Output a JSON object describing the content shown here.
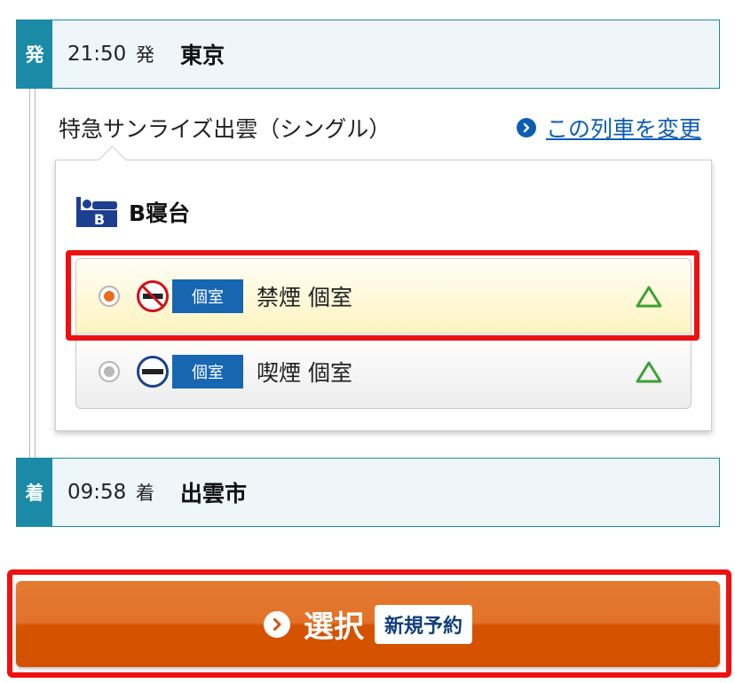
{
  "departure": {
    "mark": "発",
    "time": "21:50",
    "suffix": "発",
    "station": "東京"
  },
  "train": {
    "name": "特急サンライズ出雲（シングル）",
    "change_link": "この列車を変更"
  },
  "seat_class": {
    "title": "B寝台",
    "icon_text": "B",
    "options": [
      {
        "badge": "個室",
        "label": "禁煙 個室",
        "availability": "△",
        "selected": true,
        "smoking": false
      },
      {
        "badge": "個室",
        "label": "喫煙 個室",
        "availability": "△",
        "selected": false,
        "smoking": true
      }
    ]
  },
  "arrival": {
    "mark": "着",
    "time": "09:58",
    "suffix": "着",
    "station": "出雲市"
  },
  "action": {
    "label": "選択",
    "badge": "新規予約"
  },
  "colors": {
    "station_accent": "#1a8aa6",
    "station_bg": "#eef6fa",
    "link": "#0d5db4",
    "badge": "#1766b2",
    "availability": "#3fa034",
    "selected_radio": "#ec6b1c",
    "button": "#d95a0a",
    "highlight": "#ee1111"
  }
}
